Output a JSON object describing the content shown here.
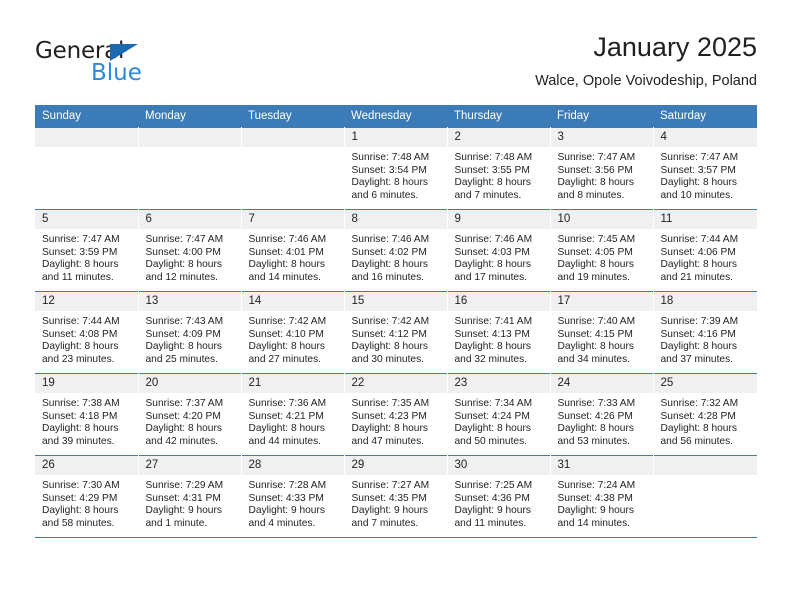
{
  "brand": {
    "name_part1": "General",
    "name_part2": "Blue",
    "triangle_color": "#1b69b0",
    "blue_color": "#2e8ad8"
  },
  "header": {
    "title": "January 2025",
    "subtitle": "Walce, Opole Voivodeship, Poland"
  },
  "theme": {
    "header_row_bg": "#3b7cb8",
    "daynum_bg": "#f0f0f0",
    "grid_line": "#3b7cb8",
    "text": "#231f20"
  },
  "weekday_headers": [
    "Sunday",
    "Monday",
    "Tuesday",
    "Wednesday",
    "Thursday",
    "Friday",
    "Saturday"
  ],
  "labels": {
    "sunrise_prefix": "Sunrise:",
    "sunset_prefix": "Sunset:",
    "daylight_prefix": "Daylight:"
  },
  "weeks": [
    [
      {
        "day": "",
        "empty": true
      },
      {
        "day": "",
        "empty": true
      },
      {
        "day": "",
        "empty": true
      },
      {
        "day": "1",
        "sunrise": "Sunrise: 7:48 AM",
        "sunset": "Sunset: 3:54 PM",
        "daylight_l1": "Daylight: 8 hours",
        "daylight_l2": "and 6 minutes."
      },
      {
        "day": "2",
        "sunrise": "Sunrise: 7:48 AM",
        "sunset": "Sunset: 3:55 PM",
        "daylight_l1": "Daylight: 8 hours",
        "daylight_l2": "and 7 minutes."
      },
      {
        "day": "3",
        "sunrise": "Sunrise: 7:47 AM",
        "sunset": "Sunset: 3:56 PM",
        "daylight_l1": "Daylight: 8 hours",
        "daylight_l2": "and 8 minutes."
      },
      {
        "day": "4",
        "sunrise": "Sunrise: 7:47 AM",
        "sunset": "Sunset: 3:57 PM",
        "daylight_l1": "Daylight: 8 hours",
        "daylight_l2": "and 10 minutes."
      }
    ],
    [
      {
        "day": "5",
        "sunrise": "Sunrise: 7:47 AM",
        "sunset": "Sunset: 3:59 PM",
        "daylight_l1": "Daylight: 8 hours",
        "daylight_l2": "and 11 minutes."
      },
      {
        "day": "6",
        "sunrise": "Sunrise: 7:47 AM",
        "sunset": "Sunset: 4:00 PM",
        "daylight_l1": "Daylight: 8 hours",
        "daylight_l2": "and 12 minutes."
      },
      {
        "day": "7",
        "sunrise": "Sunrise: 7:46 AM",
        "sunset": "Sunset: 4:01 PM",
        "daylight_l1": "Daylight: 8 hours",
        "daylight_l2": "and 14 minutes."
      },
      {
        "day": "8",
        "sunrise": "Sunrise: 7:46 AM",
        "sunset": "Sunset: 4:02 PM",
        "daylight_l1": "Daylight: 8 hours",
        "daylight_l2": "and 16 minutes."
      },
      {
        "day": "9",
        "sunrise": "Sunrise: 7:46 AM",
        "sunset": "Sunset: 4:03 PM",
        "daylight_l1": "Daylight: 8 hours",
        "daylight_l2": "and 17 minutes."
      },
      {
        "day": "10",
        "sunrise": "Sunrise: 7:45 AM",
        "sunset": "Sunset: 4:05 PM",
        "daylight_l1": "Daylight: 8 hours",
        "daylight_l2": "and 19 minutes."
      },
      {
        "day": "11",
        "sunrise": "Sunrise: 7:44 AM",
        "sunset": "Sunset: 4:06 PM",
        "daylight_l1": "Daylight: 8 hours",
        "daylight_l2": "and 21 minutes."
      }
    ],
    [
      {
        "day": "12",
        "sunrise": "Sunrise: 7:44 AM",
        "sunset": "Sunset: 4:08 PM",
        "daylight_l1": "Daylight: 8 hours",
        "daylight_l2": "and 23 minutes."
      },
      {
        "day": "13",
        "sunrise": "Sunrise: 7:43 AM",
        "sunset": "Sunset: 4:09 PM",
        "daylight_l1": "Daylight: 8 hours",
        "daylight_l2": "and 25 minutes."
      },
      {
        "day": "14",
        "sunrise": "Sunrise: 7:42 AM",
        "sunset": "Sunset: 4:10 PM",
        "daylight_l1": "Daylight: 8 hours",
        "daylight_l2": "and 27 minutes."
      },
      {
        "day": "15",
        "sunrise": "Sunrise: 7:42 AM",
        "sunset": "Sunset: 4:12 PM",
        "daylight_l1": "Daylight: 8 hours",
        "daylight_l2": "and 30 minutes."
      },
      {
        "day": "16",
        "sunrise": "Sunrise: 7:41 AM",
        "sunset": "Sunset: 4:13 PM",
        "daylight_l1": "Daylight: 8 hours",
        "daylight_l2": "and 32 minutes."
      },
      {
        "day": "17",
        "sunrise": "Sunrise: 7:40 AM",
        "sunset": "Sunset: 4:15 PM",
        "daylight_l1": "Daylight: 8 hours",
        "daylight_l2": "and 34 minutes."
      },
      {
        "day": "18",
        "sunrise": "Sunrise: 7:39 AM",
        "sunset": "Sunset: 4:16 PM",
        "daylight_l1": "Daylight: 8 hours",
        "daylight_l2": "and 37 minutes."
      }
    ],
    [
      {
        "day": "19",
        "sunrise": "Sunrise: 7:38 AM",
        "sunset": "Sunset: 4:18 PM",
        "daylight_l1": "Daylight: 8 hours",
        "daylight_l2": "and 39 minutes."
      },
      {
        "day": "20",
        "sunrise": "Sunrise: 7:37 AM",
        "sunset": "Sunset: 4:20 PM",
        "daylight_l1": "Daylight: 8 hours",
        "daylight_l2": "and 42 minutes."
      },
      {
        "day": "21",
        "sunrise": "Sunrise: 7:36 AM",
        "sunset": "Sunset: 4:21 PM",
        "daylight_l1": "Daylight: 8 hours",
        "daylight_l2": "and 44 minutes."
      },
      {
        "day": "22",
        "sunrise": "Sunrise: 7:35 AM",
        "sunset": "Sunset: 4:23 PM",
        "daylight_l1": "Daylight: 8 hours",
        "daylight_l2": "and 47 minutes."
      },
      {
        "day": "23",
        "sunrise": "Sunrise: 7:34 AM",
        "sunset": "Sunset: 4:24 PM",
        "daylight_l1": "Daylight: 8 hours",
        "daylight_l2": "and 50 minutes."
      },
      {
        "day": "24",
        "sunrise": "Sunrise: 7:33 AM",
        "sunset": "Sunset: 4:26 PM",
        "daylight_l1": "Daylight: 8 hours",
        "daylight_l2": "and 53 minutes."
      },
      {
        "day": "25",
        "sunrise": "Sunrise: 7:32 AM",
        "sunset": "Sunset: 4:28 PM",
        "daylight_l1": "Daylight: 8 hours",
        "daylight_l2": "and 56 minutes."
      }
    ],
    [
      {
        "day": "26",
        "sunrise": "Sunrise: 7:30 AM",
        "sunset": "Sunset: 4:29 PM",
        "daylight_l1": "Daylight: 8 hours",
        "daylight_l2": "and 58 minutes."
      },
      {
        "day": "27",
        "sunrise": "Sunrise: 7:29 AM",
        "sunset": "Sunset: 4:31 PM",
        "daylight_l1": "Daylight: 9 hours",
        "daylight_l2": "and 1 minute."
      },
      {
        "day": "28",
        "sunrise": "Sunrise: 7:28 AM",
        "sunset": "Sunset: 4:33 PM",
        "daylight_l1": "Daylight: 9 hours",
        "daylight_l2": "and 4 minutes."
      },
      {
        "day": "29",
        "sunrise": "Sunrise: 7:27 AM",
        "sunset": "Sunset: 4:35 PM",
        "daylight_l1": "Daylight: 9 hours",
        "daylight_l2": "and 7 minutes."
      },
      {
        "day": "30",
        "sunrise": "Sunrise: 7:25 AM",
        "sunset": "Sunset: 4:36 PM",
        "daylight_l1": "Daylight: 9 hours",
        "daylight_l2": "and 11 minutes."
      },
      {
        "day": "31",
        "sunrise": "Sunrise: 7:24 AM",
        "sunset": "Sunset: 4:38 PM",
        "daylight_l1": "Daylight: 9 hours",
        "daylight_l2": "and 14 minutes."
      },
      {
        "day": "",
        "empty": true
      }
    ]
  ]
}
